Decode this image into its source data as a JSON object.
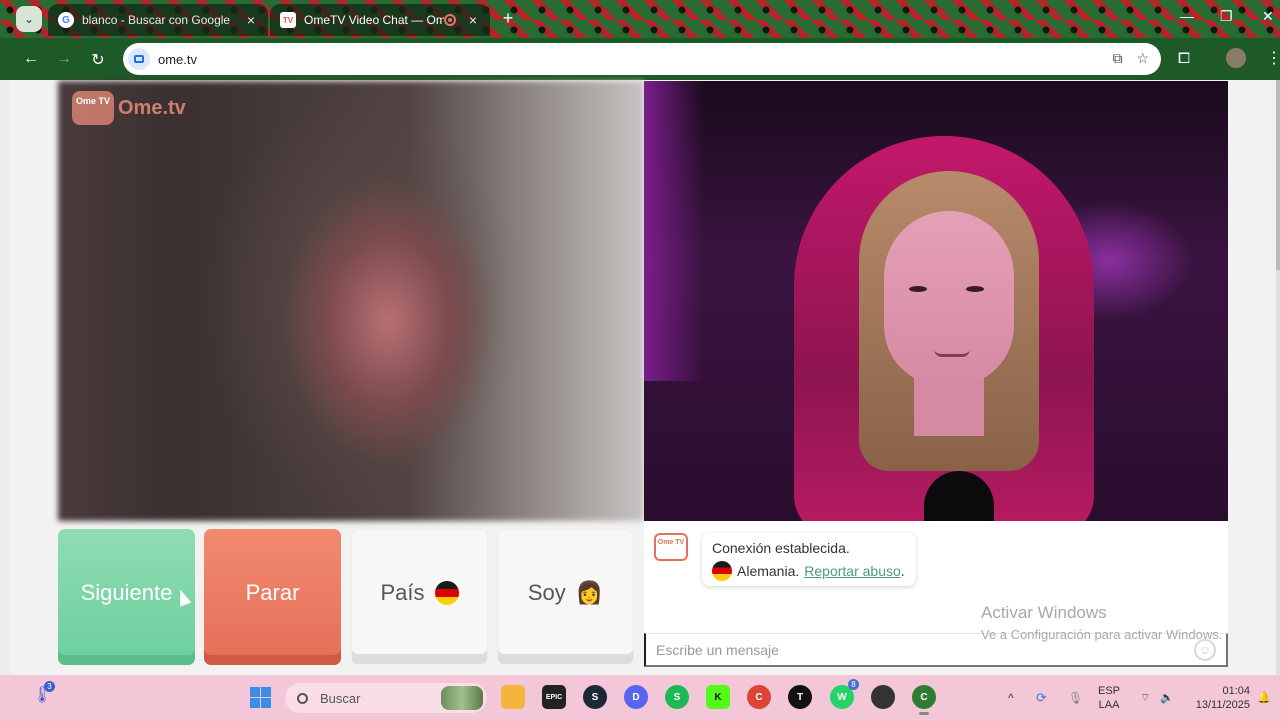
{
  "browser": {
    "tabs": [
      {
        "title": "blanco - Buscar con Google",
        "favicon": "google-icon",
        "active": false
      },
      {
        "title": "OmeTV Video Chat — Ome",
        "favicon": "ometv-icon",
        "active": true,
        "recording": true
      }
    ],
    "new_tab_symbol": "+",
    "url": "ome.tv",
    "tabstrip_color": "#2a6b33",
    "toolbar_color": "#1e5a28"
  },
  "site": {
    "logo_tv_text": "Ome TV",
    "logo_word": "Ome.tv",
    "buttons": {
      "next": "Siguiente",
      "stop": "Parar",
      "country": "País",
      "gender": "Soy"
    },
    "country_flag": "germany-flag-icon",
    "gender_icon": "person-icon",
    "colors": {
      "next": "#6ccf9c",
      "stop": "#e46f57",
      "link": "#4c9a86",
      "brand": "#e36f5e"
    },
    "chat": {
      "system_tv_text": "Ome TV",
      "connection_message": "Conexión establecida.",
      "country_name": "Alemania.",
      "report_link": "Reportar abuso",
      "report_suffix": ".",
      "input_placeholder": "Escribe un mensaje"
    }
  },
  "watermark": {
    "title": "Activar Windows",
    "subtitle": "Ve a Configuración para activar Windows."
  },
  "taskbar": {
    "weather_badge": "3",
    "search_placeholder": "Buscar",
    "apps": [
      {
        "name": "file-explorer-icon",
        "color": "#f2b43a",
        "label": ""
      },
      {
        "name": "epic-games-icon",
        "color": "#222222",
        "label": "EPIC"
      },
      {
        "name": "steam-icon",
        "color": "#1b2838",
        "label": "S"
      },
      {
        "name": "discord-icon",
        "color": "#5865f2",
        "label": "D"
      },
      {
        "name": "spotify-icon",
        "color": "#1db954",
        "label": "S"
      },
      {
        "name": "kick-icon",
        "color": "#53fc18",
        "label": "K"
      },
      {
        "name": "chrome-icon",
        "color": "#db4437",
        "label": "C"
      },
      {
        "name": "tiktok-icon",
        "color": "#111111",
        "label": "T"
      },
      {
        "name": "whatsapp-icon",
        "color": "#25d366",
        "label": "W",
        "badge": "8"
      },
      {
        "name": "app-icon",
        "color": "#333333",
        "label": ""
      },
      {
        "name": "chrome-profile-icon",
        "color": "#2e7d32",
        "label": "C"
      }
    ],
    "lang_line1": "ESP",
    "lang_line2": "LAA",
    "time": "01:04",
    "date": "13/11/2025"
  }
}
